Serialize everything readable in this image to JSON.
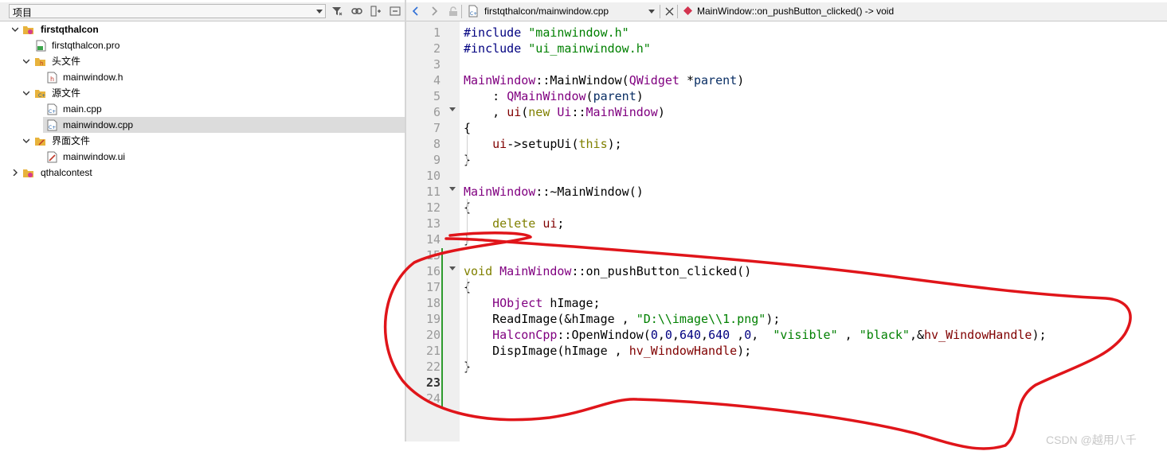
{
  "project_pane": {
    "selector_label": "项目",
    "icons": [
      "filter-icon",
      "link-icon",
      "split-icon",
      "close-pane-icon"
    ],
    "tree": [
      {
        "label": "firstqthalcon",
        "level": 0,
        "expanded": true,
        "bold": true,
        "icon": "project-icon"
      },
      {
        "label": "firstqthalcon.pro",
        "level": 1,
        "icon": "pro-file-icon"
      },
      {
        "label": "头文件",
        "level": 1,
        "expanded": true,
        "icon": "header-folder-icon"
      },
      {
        "label": "mainwindow.h",
        "level": 2,
        "icon": "header-file-icon"
      },
      {
        "label": "源文件",
        "level": 1,
        "expanded": true,
        "icon": "source-folder-icon"
      },
      {
        "label": "main.cpp",
        "level": 2,
        "icon": "cpp-file-icon"
      },
      {
        "label": "mainwindow.cpp",
        "level": 2,
        "selected": true,
        "icon": "cpp-file-icon"
      },
      {
        "label": "界面文件",
        "level": 1,
        "expanded": true,
        "icon": "form-folder-icon"
      },
      {
        "label": "mainwindow.ui",
        "level": 2,
        "icon": "ui-file-icon"
      },
      {
        "label": "qthalcontest",
        "level": 0,
        "expanded": false,
        "icon": "project-icon"
      }
    ]
  },
  "editor_bar": {
    "file_name": "firstqthalcon/mainwindow.cpp",
    "symbol": "MainWindow::on_pushButton_clicked() -> void"
  },
  "editor": {
    "current_line": 23,
    "line_numbers": [
      "1",
      "2",
      "3",
      "4",
      "5",
      "6",
      "7",
      "8",
      "9",
      "10",
      "11",
      "12",
      "13",
      "14",
      "15",
      "16",
      "17",
      "18",
      "19",
      "20",
      "21",
      "22",
      "23",
      "24"
    ],
    "lines": [
      [
        [
          "k-pp",
          "#include "
        ],
        [
          "k-str",
          "\"mainwindow.h\""
        ]
      ],
      [
        [
          "k-pp",
          "#include "
        ],
        [
          "k-str",
          "\"ui_mainwindow.h\""
        ]
      ],
      [],
      [
        [
          "k-type",
          "MainWindow"
        ],
        [
          "",
          "::MainWindow("
        ],
        [
          "k-type",
          "QWidget"
        ],
        [
          "",
          " *"
        ],
        [
          "k-var",
          "parent"
        ],
        [
          "",
          ")"
        ]
      ],
      [
        [
          "",
          "    : "
        ],
        [
          "k-type",
          "QMainWindow"
        ],
        [
          "",
          "("
        ],
        [
          "k-var",
          "parent"
        ],
        [
          "",
          ")"
        ]
      ],
      [
        [
          "",
          "    , "
        ],
        [
          "k-mem",
          "ui"
        ],
        [
          "",
          "("
        ],
        [
          "k-kw",
          "new"
        ],
        [
          "",
          " "
        ],
        [
          "k-type",
          "Ui"
        ],
        [
          "",
          "::"
        ],
        [
          "k-type",
          "MainWindow"
        ],
        [
          "",
          ")"
        ]
      ],
      [
        [
          "",
          "{"
        ]
      ],
      [
        [
          "",
          "    "
        ],
        [
          "k-mem",
          "ui"
        ],
        [
          "",
          "->setupUi("
        ],
        [
          "k-kw",
          "this"
        ],
        [
          "",
          ");"
        ]
      ],
      [
        [
          "",
          "}"
        ]
      ],
      [],
      [
        [
          "k-type",
          "MainWindow"
        ],
        [
          "",
          "::~MainWindow()"
        ]
      ],
      [
        [
          "",
          "{"
        ]
      ],
      [
        [
          "",
          "    "
        ],
        [
          "k-kw",
          "delete"
        ],
        [
          "",
          " "
        ],
        [
          "k-mem",
          "ui"
        ],
        [
          "",
          ";"
        ]
      ],
      [
        [
          "",
          "}"
        ]
      ],
      [],
      [
        [
          "k-kw",
          "void"
        ],
        [
          "",
          " "
        ],
        [
          "k-type",
          "MainWindow"
        ],
        [
          "",
          "::on_pushButton_clicked()"
        ]
      ],
      [
        [
          "",
          "{"
        ]
      ],
      [
        [
          "",
          "    "
        ],
        [
          "k-type",
          "HObject"
        ],
        [
          "",
          " hImage;"
        ]
      ],
      [
        [
          "",
          "    ReadImage(&hImage , "
        ],
        [
          "k-str",
          "\"D:\\\\image\\\\1.png\""
        ],
        [
          "",
          ");"
        ]
      ],
      [
        [
          "",
          "    "
        ],
        [
          "k-type",
          "HalconCpp"
        ],
        [
          "",
          "::OpenWindow("
        ],
        [
          "k-num",
          "0"
        ],
        [
          "",
          ","
        ],
        [
          "k-num",
          "0"
        ],
        [
          "",
          ","
        ],
        [
          "k-num",
          "640"
        ],
        [
          "",
          ","
        ],
        [
          "k-num",
          "640"
        ],
        [
          "",
          " ,"
        ],
        [
          "k-num",
          "0"
        ],
        [
          "",
          ",  "
        ],
        [
          "k-str",
          "\"visible\""
        ],
        [
          "",
          " , "
        ],
        [
          "k-str",
          "\"black\""
        ],
        [
          "",
          ",&"
        ],
        [
          "k-mem",
          "hv_WindowHandle"
        ],
        [
          "",
          ");"
        ]
      ],
      [
        [
          "",
          "    DispImage(hImage , "
        ],
        [
          "k-mem",
          "hv_WindowHandle"
        ],
        [
          "",
          ");"
        ]
      ],
      [
        [
          "",
          "}"
        ]
      ],
      [],
      []
    ]
  },
  "watermark": "CSDN @越用八千"
}
